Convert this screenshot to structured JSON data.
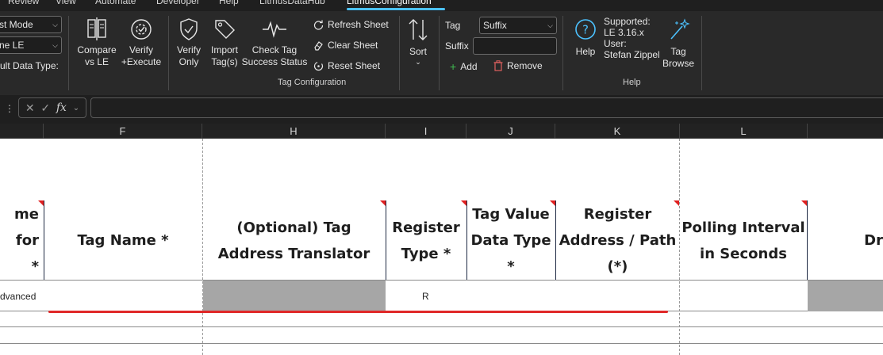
{
  "ribbon": {
    "menu_tabs": [
      "Review",
      "View",
      "Automate",
      "Developer",
      "Help",
      "LitmusDataHub",
      "LitmusConfiguration"
    ],
    "active_tab": "LitmusConfiguration",
    "left_group": {
      "mode_dropdown": "st Mode",
      "le_dropdown": "ne LE",
      "data_type_label": "ult Data Type:"
    },
    "buttons": {
      "compare": "Compare\nvs LE",
      "verify_execute": "Verify\n+Execute",
      "verify_only": "Verify\nOnly",
      "import_tags": "Import\nTag(s)",
      "check_tag": "Check Tag\nSuccess Status",
      "refresh_sheet": "Refresh Sheet",
      "clear_sheet": "Clear Sheet",
      "reset_sheet": "Reset Sheet",
      "sort": "Sort",
      "tag_label": "Tag",
      "tag_dropdown": "Suffix",
      "suffix_label": "Suffix",
      "suffix_value": "",
      "add": "Add",
      "remove": "Remove",
      "help": "Help",
      "tag_browse": "Tag\nBrowse"
    },
    "group_labels": {
      "tag_configuration": "Tag Configuration",
      "help": "Help"
    },
    "help_info": {
      "supported_label": "Supported:",
      "supported_value": "LE 3.16.x",
      "user_label": "User:",
      "user_value": "Stefan Zippel"
    }
  },
  "formula_bar": {
    "fx_label": "fx",
    "value": ""
  },
  "columns": [
    "F",
    "H",
    "I",
    "J",
    "K",
    "L"
  ],
  "header_row": {
    "cut_left": "me for\n*",
    "tag_name": "Tag Name *",
    "address_translator": "(Optional) Tag\nAddress Translator",
    "register_type": "Register\nType *",
    "value_data_type": "Tag Value\nData Type\n*",
    "register_address": "Register\nAddress / Path\n(*)",
    "polling_interval": "Polling Interval\nin Seconds",
    "cut_right": "Dr"
  },
  "data_row": {
    "cut_left": "dvanced",
    "register_type": "R"
  },
  "colors": {
    "ribbon_bg": "#292929",
    "accent": "#4cc2ff",
    "error_red": "#e02828",
    "grey_cell": "#a6a6a6"
  }
}
